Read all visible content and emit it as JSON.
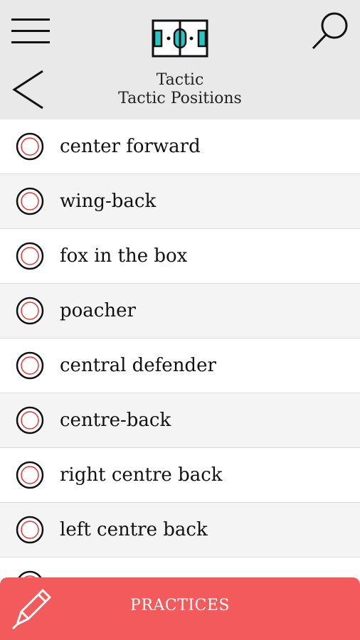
{
  "header": {
    "title": "Tactic",
    "subtitle": "Tactic Positions",
    "icons": {
      "menu": "hamburger-menu-icon",
      "search": "search-icon",
      "back": "back-arrow-icon",
      "logo": "football-pitch-icon"
    }
  },
  "positions": [
    "center forward",
    "wing-back",
    "fox in the box",
    "poacher",
    "central defender",
    "centre-back",
    "right centre back",
    "left centre back",
    ""
  ],
  "footer": {
    "button_label": "PRACTICES",
    "icon": "pencil-icon"
  },
  "colors": {
    "header_bg": "#e9e9e9",
    "accent_red": "#f25a5c",
    "check_ring": "#e53935",
    "pitch_teal": "#2bc4c4"
  }
}
